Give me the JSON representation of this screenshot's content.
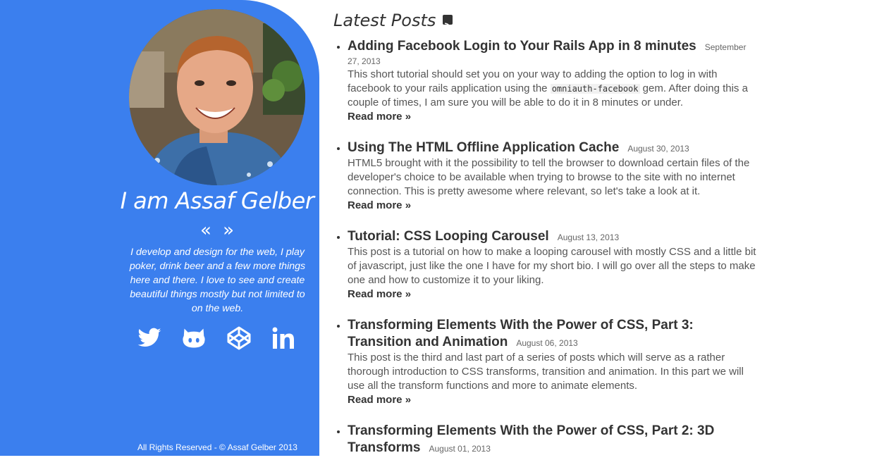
{
  "sidebar": {
    "name": "I am Assaf Gelber",
    "prev_arrow": "«",
    "next_arrow": "»",
    "bio": "I develop and design for the web, I play poker, drink beer and a few more things here and there. I love to see and create beautiful things mostly but not limited to on the web.",
    "social": [
      {
        "name": "twitter-icon"
      },
      {
        "name": "github-icon"
      },
      {
        "name": "codepen-icon"
      },
      {
        "name": "linkedin-icon"
      }
    ],
    "footer": "All Rights Reserved - © Assaf Gelber 2013",
    "bg_color": "#3b7fee"
  },
  "main": {
    "title": "Latest Posts",
    "rss_icon": "rss-icon",
    "read_more": "Read more »",
    "posts": [
      {
        "title": "Adding Facebook Login to Your Rails App in 8 minutes",
        "date": "September 27, 2013",
        "excerpt_before": "This short tutorial should set you on your way to adding the option to log in with facebook to your rails application using the ",
        "excerpt_code": "omniauth-facebook",
        "excerpt_after": " gem. After doing this a couple of times, I am sure you will be able to do it in 8 minutes or under."
      },
      {
        "title": "Using The HTML Offline Application Cache",
        "date": "August 30, 2013",
        "excerpt": "HTML5 brought with it the possibility to tell the browser to download certain files of the developer's choice to be available when trying to browse to the site with no internet connection. This is pretty awesome where relevant, so let's take a look at it."
      },
      {
        "title": "Tutorial: CSS Looping Carousel",
        "date": "August 13, 2013",
        "excerpt": "This post is a tutorial on how to make a looping carousel with mostly CSS and a little bit of javascript, just like the one I have for my short bio. I will go over all the steps to make one and how to customize it to your liking."
      },
      {
        "title": "Transforming Elements With the Power of CSS, Part 3: Transition and Animation",
        "date": "August 06, 2013",
        "excerpt": "This post is the third and last part of a series of posts which will serve as a rather thorough introduction to CSS transforms, transition and animation. In this part we will use all the transform functions and more to animate elements."
      },
      {
        "title": "Transforming Elements With the Power of CSS, Part 2: 3D Transforms",
        "date": "August 01, 2013"
      }
    ]
  }
}
